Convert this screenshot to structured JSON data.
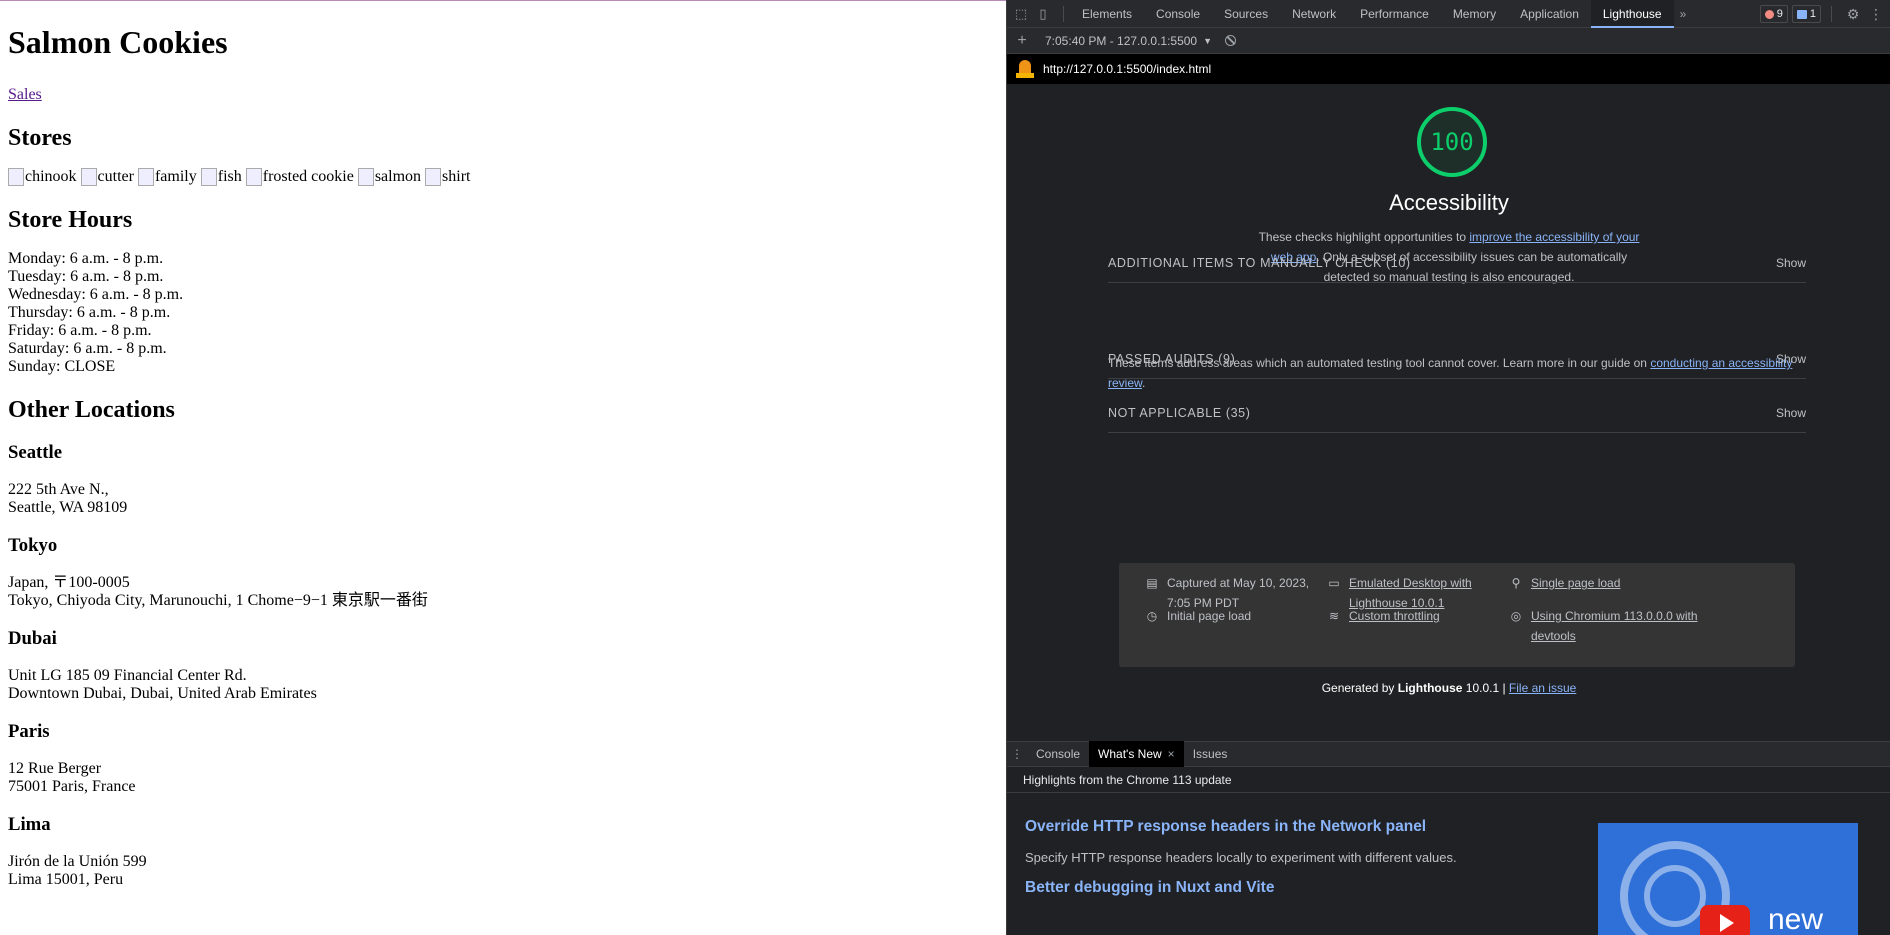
{
  "page": {
    "title": "Salmon Cookies",
    "nav_link": "Sales",
    "stores_heading": "Stores",
    "images": [
      "chinook",
      "cutter",
      "family",
      "fish",
      "frosted cookie",
      "salmon",
      "shirt"
    ],
    "hours_heading": "Store Hours",
    "hours": [
      "Monday: 6 a.m. - 8 p.m.",
      "Tuesday: 6 a.m. - 8 p.m.",
      "Wednesday: 6 a.m. - 8 p.m.",
      "Thursday: 6 a.m. - 8 p.m.",
      "Friday: 6 a.m. - 8 p.m.",
      "Saturday: 6 a.m. - 8 p.m.",
      "Sunday: CLOSE"
    ],
    "locations_heading": "Other Locations",
    "locations": [
      {
        "name": "Seattle",
        "line1": "222 5th Ave N.,",
        "line2": "Seattle, WA 98109"
      },
      {
        "name": "Tokyo",
        "line1": "Japan, 〒100-0005",
        "line2": "Tokyo, Chiyoda City, Marunouchi, 1 Chome−9−1 東京駅一番街"
      },
      {
        "name": "Dubai",
        "line1": "Unit LG 185 09 Financial Center Rd.",
        "line2": "Downtown Dubai, Dubai, United Arab Emirates"
      },
      {
        "name": "Paris",
        "line1": "12 Rue Berger",
        "line2": "75001 Paris, France"
      },
      {
        "name": "Lima",
        "line1": "Jirón de la Unión 599",
        "line2": "Lima 15001, Peru"
      }
    ]
  },
  "devtools": {
    "tabs": [
      "Elements",
      "Console",
      "Sources",
      "Network",
      "Performance",
      "Memory",
      "Application",
      "Lighthouse"
    ],
    "active_tab": "Lighthouse",
    "more_tabs": "»",
    "error_count": "9",
    "message_count": "1",
    "toolbar": {
      "report_label": "7:05:40 PM - 127.0.0.1:5500",
      "dropdown": "▼"
    },
    "url": "http://127.0.0.1:5500/index.html",
    "score": "100",
    "category": "Accessibility",
    "desc": {
      "pre": "These checks highlight opportunities to ",
      "link": "improve the accessibility of your web app",
      "post": ". Only a subset of accessibility issues can be automatically detected so manual testing is also encouraged."
    },
    "groups": {
      "manual": "ADDITIONAL ITEMS TO MANUALLY CHECK (10)",
      "manual_desc_pre": "These items address areas which an automated testing tool cannot cover. Learn more in our guide on ",
      "manual_desc_link": "conducting an accessibility review",
      "manual_desc_post": ".",
      "passed": "PASSED AUDITS (9)",
      "na": "NOT APPLICABLE (35)",
      "show": "Show"
    },
    "runtime": {
      "captured": "Captured at May 10, 2023, 7:05 PM PDT",
      "initial_load": "Initial page load",
      "emulated": "Emulated Desktop with Lighthouse 10.0.1",
      "throttling": "Custom throttling",
      "single_page": "Single page load",
      "chromium": "Using Chromium 113.0.0.0 with devtools"
    },
    "footer": {
      "generated": "Generated by ",
      "brand": "Lighthouse",
      "version": " 10.0.1 | ",
      "issue_link": "File an issue"
    },
    "drawer": {
      "tabs": [
        "Console",
        "What's New",
        "Issues"
      ],
      "active": "What's New",
      "close": "×",
      "header": "Highlights from the Chrome 113 update",
      "items": [
        {
          "title": "Override HTTP response headers in the Network panel",
          "desc": "Specify HTTP response headers locally to experiment with different values."
        },
        {
          "title": "Better debugging in Nuxt and Vite",
          "desc": ""
        }
      ],
      "thumb_text": "new"
    },
    "colors": {
      "score_green": "#0cce6b",
      "link_blue": "#8ab4f8",
      "panel_bg": "#202124"
    }
  }
}
